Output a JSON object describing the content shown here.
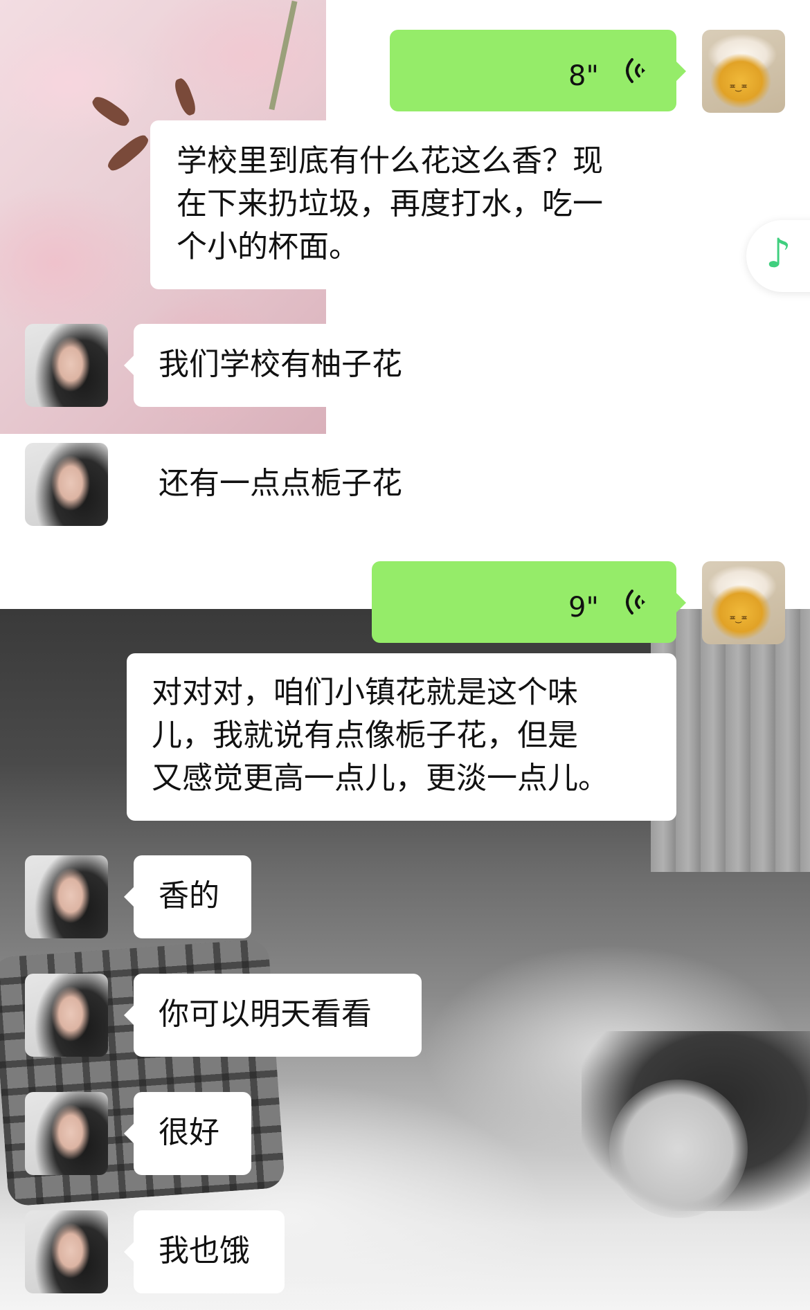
{
  "chat": {
    "messages": [
      {
        "from": "me",
        "type": "voice",
        "duration": "8\""
      },
      {
        "from": "transcript",
        "type": "text",
        "lines": [
          "学校里到底有什么花这么香？现",
          "在下来扔垃圾，再度打水，吃一",
          "个小的杯面。"
        ]
      },
      {
        "from": "her",
        "type": "text",
        "text": "我们学校有柚子花"
      },
      {
        "from": "her",
        "type": "text",
        "text": "还有一点点栀子花"
      },
      {
        "from": "me",
        "type": "voice",
        "duration": "9\""
      },
      {
        "from": "transcript",
        "type": "text",
        "lines": [
          "对对对，咱们小镇花就是这个味",
          "儿，我就说有点像栀子花，但是",
          "又感觉更高一点儿，更淡一点儿。"
        ]
      },
      {
        "from": "her",
        "type": "text",
        "text": "香的"
      },
      {
        "from": "her",
        "type": "text",
        "text": "你可以明天看看"
      },
      {
        "from": "her",
        "type": "text",
        "text": "很好"
      },
      {
        "from": "her",
        "type": "text",
        "text": "我也饿"
      }
    ]
  },
  "floating_music": {
    "icon": "music-note-icon",
    "glyph": "♪",
    "color": "#3fcf7e"
  },
  "colors": {
    "bubble_green": "#95ec69",
    "bubble_white": "#ffffff"
  }
}
